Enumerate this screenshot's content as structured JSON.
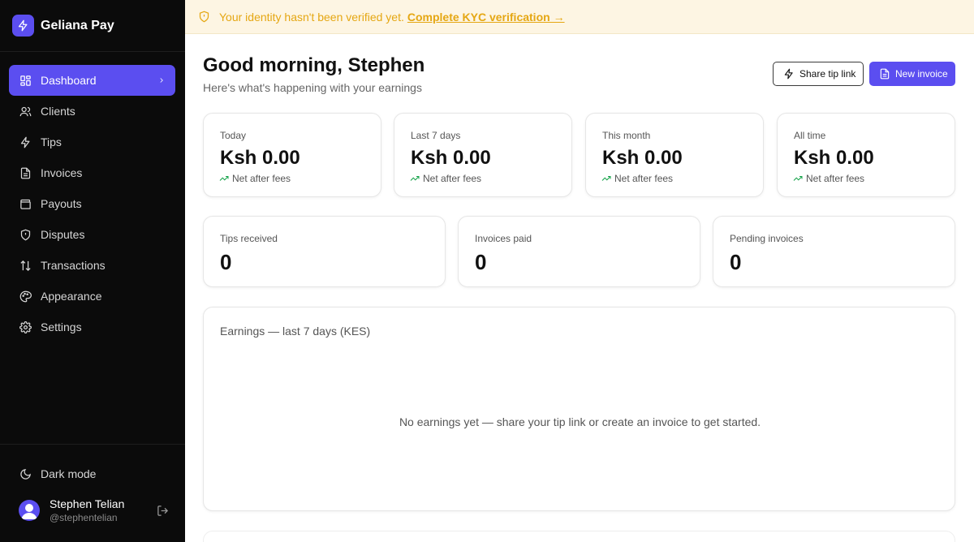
{
  "app": {
    "name": "Geliana Pay",
    "brand_color": "#5b4ef0"
  },
  "sidebar": {
    "items": [
      {
        "label": "Dashboard",
        "icon": "dashboard-grid-icon",
        "active": true
      },
      {
        "label": "Clients",
        "icon": "users-icon"
      },
      {
        "label": "Tips",
        "icon": "lightning-icon"
      },
      {
        "label": "Invoices",
        "icon": "document-icon"
      },
      {
        "label": "Payouts",
        "icon": "wallet-icon"
      },
      {
        "label": "Disputes",
        "icon": "shield-icon"
      },
      {
        "label": "Transactions",
        "icon": "arrows-up-down-icon"
      },
      {
        "label": "Appearance",
        "icon": "palette-icon"
      },
      {
        "label": "Settings",
        "icon": "gear-icon"
      }
    ],
    "dark_mode_label": "Dark mode",
    "user": {
      "name": "Stephen Telian",
      "handle": "@stephentelian"
    }
  },
  "banner": {
    "message": "Your identity hasn't been verified yet.",
    "link": "Complete KYC verification →",
    "color": "#e5a713"
  },
  "header": {
    "greeting": "Good morning, Stephen",
    "subtitle": "Here's what's happening with your earnings",
    "share_button": "Share tip link",
    "new_invoice_button": "New invoice"
  },
  "stats": [
    {
      "label": "Today",
      "amount": "Ksh 0.00",
      "note": "Net after fees"
    },
    {
      "label": "Last 7 days",
      "amount": "Ksh 0.00",
      "note": "Net after fees"
    },
    {
      "label": "This month",
      "amount": "Ksh 0.00",
      "note": "Net after fees"
    },
    {
      "label": "All time",
      "amount": "Ksh 0.00",
      "note": "Net after fees"
    }
  ],
  "counts": [
    {
      "label": "Tips received",
      "value": "0"
    },
    {
      "label": "Invoices paid",
      "value": "0"
    },
    {
      "label": "Pending invoices",
      "value": "0"
    }
  ],
  "chart": {
    "title": "Earnings — last 7 days (KES)",
    "empty_message": "No earnings yet — share your tip link or create an invoice to get started."
  }
}
